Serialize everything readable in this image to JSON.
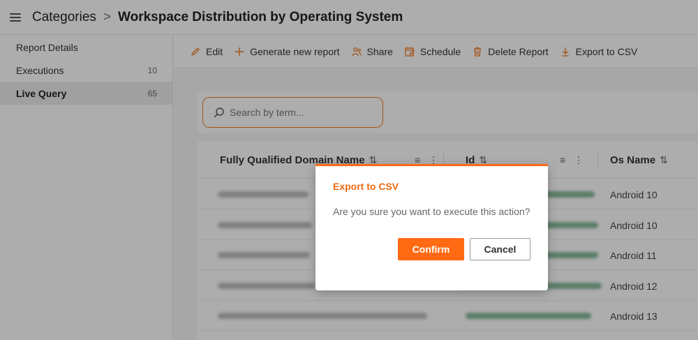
{
  "header": {
    "breadcrumb_root": "Categories",
    "breadcrumb_separator": ">",
    "title": "Workspace Distribution by Operating System"
  },
  "sidebar": {
    "items": [
      {
        "label": "Report Details",
        "count": ""
      },
      {
        "label": "Executions",
        "count": "10"
      },
      {
        "label": "Live Query",
        "count": "65",
        "active": true
      }
    ]
  },
  "toolbar": {
    "edit": "Edit",
    "generate": "Generate new report",
    "share": "Share",
    "schedule": "Schedule",
    "delete": "Delete Report",
    "export": "Export to CSV"
  },
  "search": {
    "placeholder": "Search by term...",
    "value": ""
  },
  "table": {
    "columns": [
      {
        "label": "Fully Qualified Domain Name",
        "sort": "⇅"
      },
      {
        "label": "Id",
        "sort": "⇅"
      },
      {
        "label": "Os Name",
        "sort": "⇅"
      }
    ],
    "rows": [
      {
        "os_name": "Android 10"
      },
      {
        "os_name": "Android 10"
      },
      {
        "os_name": "Android 11"
      },
      {
        "os_name": "Android 12"
      },
      {
        "os_name": "Android 13"
      }
    ]
  },
  "dialog": {
    "title": "Export to CSV",
    "message": "Are you sure you want to execute this action?",
    "confirm_label": "Confirm",
    "cancel_label": "Cancel"
  },
  "colors": {
    "accent": "#ff6a13",
    "accent_text": "#f06a10"
  },
  "icons": {
    "menu": "hamburger-icon",
    "edit": "pencil-icon",
    "generate": "plus-icon",
    "share": "share-users-icon",
    "schedule": "calendar-edit-icon",
    "delete": "trash-icon",
    "export": "download-icon",
    "search": "search-icon",
    "filter": "filter-icon",
    "more": "kebab-menu-icon"
  }
}
